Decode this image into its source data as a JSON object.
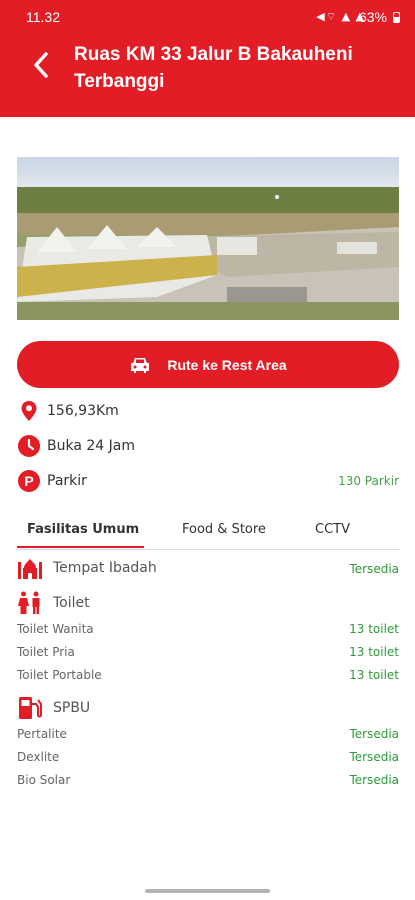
{
  "status_bar": {
    "time": "11.32",
    "indicators": "◀⌔ ▲ ▲",
    "battery": "63%"
  },
  "header": {
    "title": "Ruas KM 33 Jalur B Bakauheni Terbanggi"
  },
  "route_button": {
    "label": "Rute ke Rest Area"
  },
  "info": {
    "distance": "156,93Km",
    "hours": "Buka 24 Jam",
    "parking_label": "Parkir",
    "parking_value": "130 Parkir"
  },
  "tabs": [
    "Fasilitas Umum",
    "Food & Store",
    "CCTV"
  ],
  "facilities": {
    "ibadah": {
      "label": "Tempat Ibadah",
      "status": "Tersedia"
    },
    "toilet": {
      "label": "Toilet",
      "items": [
        {
          "name": "Toilet Wanita",
          "value": "13 toilet"
        },
        {
          "name": "Toilet Pria",
          "value": "13 toilet"
        },
        {
          "name": "Toilet Portable",
          "value": "13 toilet"
        }
      ]
    },
    "spbu": {
      "label": "SPBU",
      "items": [
        {
          "name": "Pertalite",
          "value": "Tersedia"
        },
        {
          "name": "Dexlite",
          "value": "Tersedia"
        },
        {
          "name": "Bio Solar",
          "value": "Tersedia"
        }
      ]
    }
  },
  "colors": {
    "brand_red": "#e31d25",
    "available_green": "#2e9b3a"
  }
}
